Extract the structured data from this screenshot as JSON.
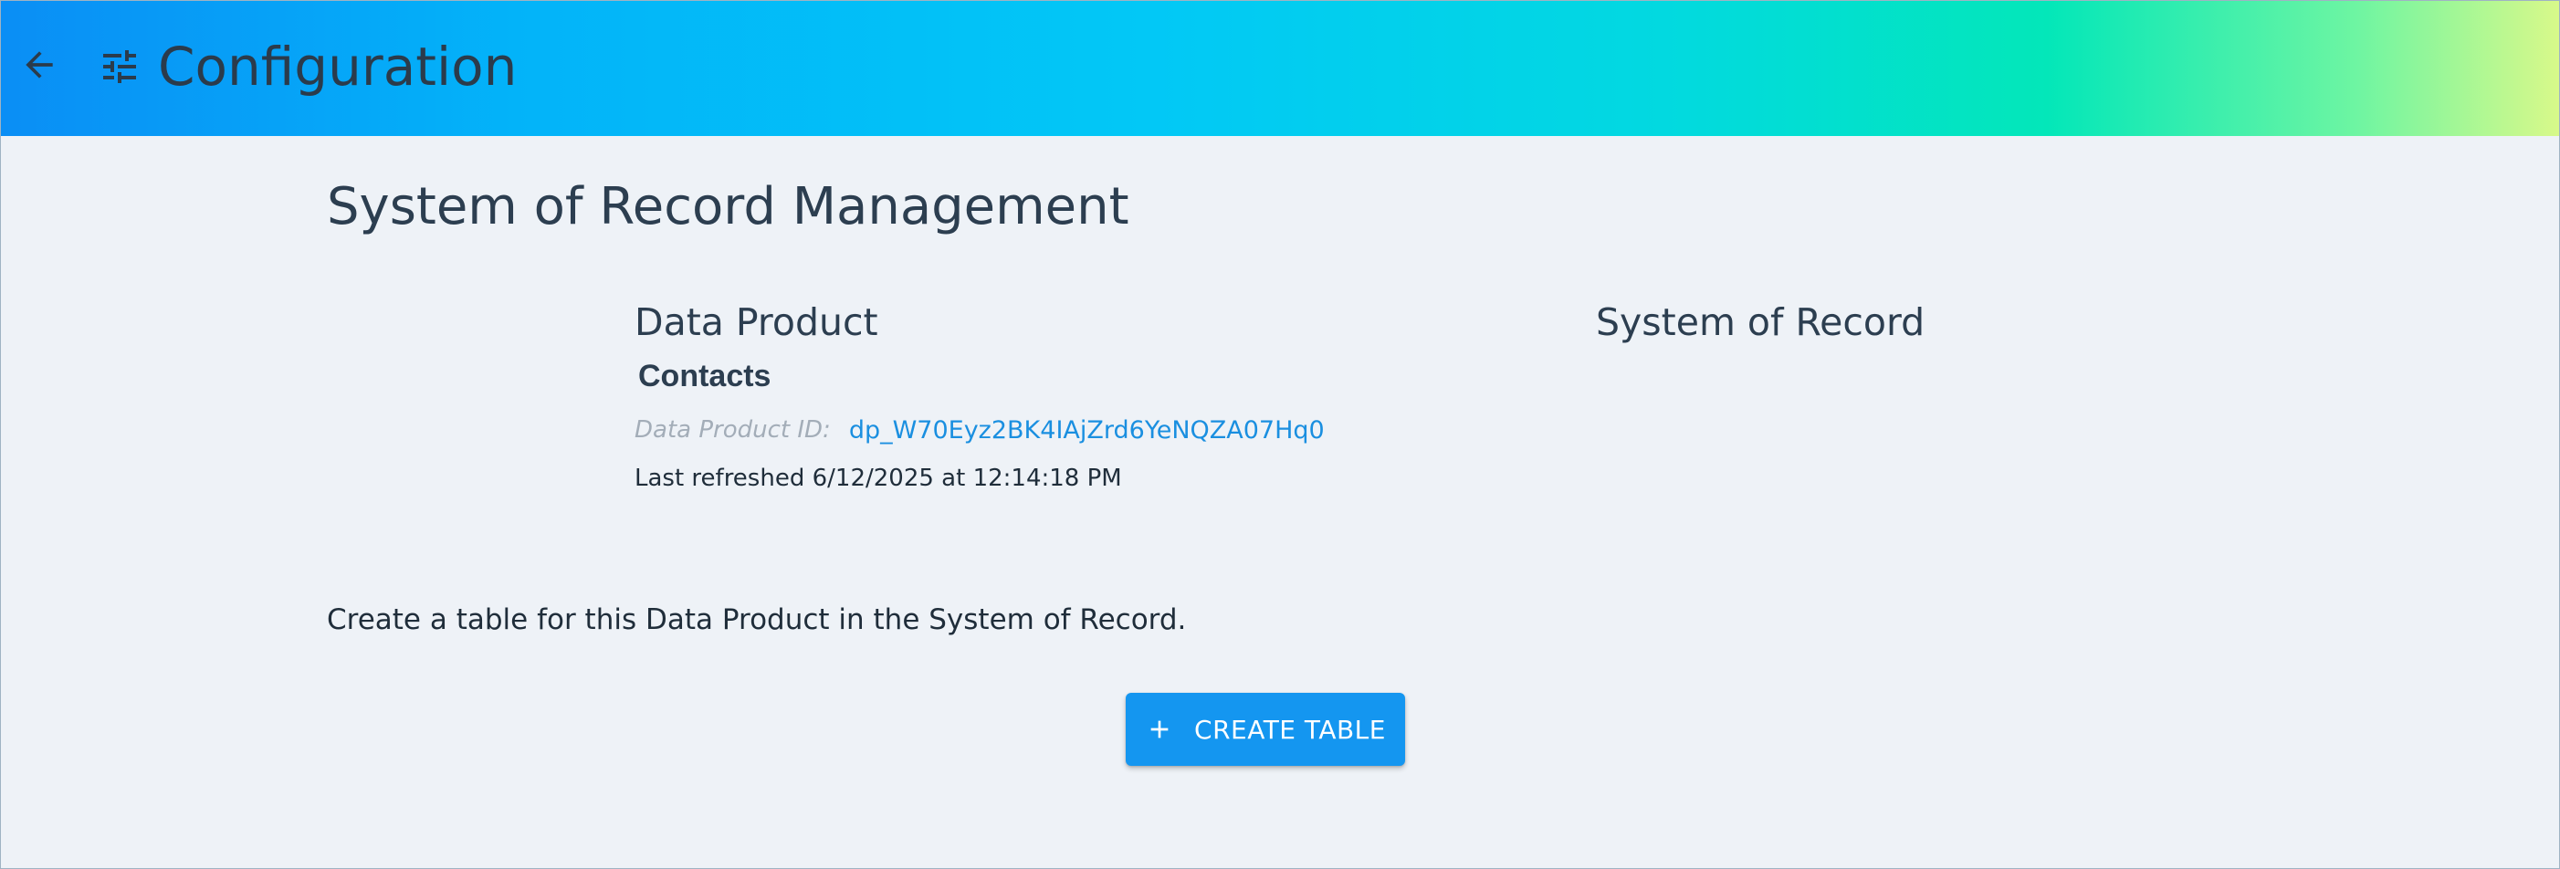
{
  "header": {
    "title": "Configuration",
    "back_icon": "arrow-left-icon",
    "settings_icon": "tune-icon"
  },
  "page": {
    "title": "System of Record Management"
  },
  "data_product": {
    "heading": "Data Product",
    "name": "Contacts",
    "id_label": "Data Product ID:",
    "id_value": "dp_W70Eyz2BK4IAjZrd6YeNQZA07Hq0",
    "last_refreshed": "Last refreshed 6/12/2025 at 12:14:18 PM"
  },
  "system_of_record": {
    "heading": "System of Record"
  },
  "instruction": "Create a table for this Data Product in the System of Record.",
  "actions": {
    "create_table_label": "CREATE TABLE",
    "create_table_icon": "plus-icon"
  },
  "colors": {
    "accent": "#1496f0",
    "link": "#1a8fe0",
    "text": "#2c3e50",
    "background": "#eef2f7"
  }
}
